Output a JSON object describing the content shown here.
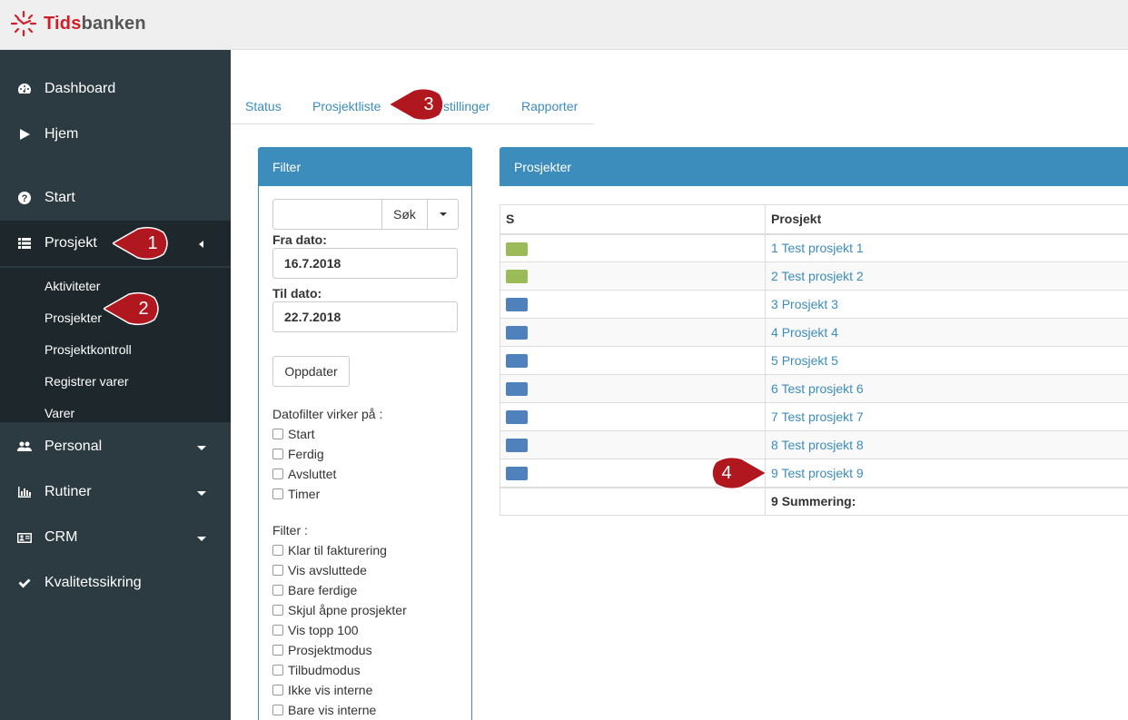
{
  "app": {
    "logo_part1": "Tids",
    "logo_part2": "banken"
  },
  "sidebar": {
    "items": [
      {
        "label": "Dashboard",
        "icon": "dashboard-icon"
      },
      {
        "label": "Hjem",
        "icon": "play-icon"
      },
      {
        "label": "Start",
        "icon": "question-icon"
      },
      {
        "label": "Prosjekt",
        "icon": "list-icon",
        "expanded": true
      },
      {
        "label": "Personal",
        "icon": "users-icon"
      },
      {
        "label": "Rutiner",
        "icon": "bar-chart-icon"
      },
      {
        "label": "CRM",
        "icon": "id-card-icon"
      },
      {
        "label": "Kvalitetssikring",
        "icon": "check-icon"
      }
    ],
    "submenu": [
      "Aktiviteter",
      "Prosjekter",
      "Prosjektkontroll",
      "Registrer varer",
      "Varer"
    ]
  },
  "tabs": [
    "Status",
    "Prosjektliste",
    "stillinger",
    "Rapporter"
  ],
  "filter": {
    "title": "Filter",
    "search_value": "",
    "search_button": "Søk",
    "from_label": "Fra dato:",
    "from_value": "16.7.2018",
    "to_label": "Til dato:",
    "to_value": "22.7.2018",
    "update_button": "Oppdater",
    "datefilter_label": "Datofilter virker på :",
    "datefilter_options": [
      "Start",
      "Ferdig",
      "Avsluttet",
      "Timer"
    ],
    "filter_label": "Filter :",
    "filter_options": [
      "Klar til fakturering",
      "Vis avsluttede",
      "Bare ferdige",
      "Skjul åpne prosjekter",
      "Vis topp 100",
      "Prosjektmodus",
      "Tilbudmodus",
      "Ikke vis interne",
      "Bare vis interne"
    ]
  },
  "projects": {
    "title": "Prosjekter",
    "col_status": "S",
    "col_project": "Prosjekt",
    "rows": [
      {
        "num": "1",
        "name": "Test prosjekt 1",
        "color": "#9bbb59"
      },
      {
        "num": "2",
        "name": "Test prosjekt 2",
        "color": "#9bbb59"
      },
      {
        "num": "3",
        "name": "Prosjekt 3",
        "color": "#4f81bd"
      },
      {
        "num": "4",
        "name": "Prosjekt 4",
        "color": "#4f81bd"
      },
      {
        "num": "5",
        "name": "Prosjekt 5",
        "color": "#4f81bd"
      },
      {
        "num": "6",
        "name": "Test prosjekt 6",
        "color": "#4f81bd"
      },
      {
        "num": "7",
        "name": "Test prosjekt 7",
        "color": "#4f81bd"
      },
      {
        "num": "8",
        "name": "Test prosjekt 8",
        "color": "#4f81bd"
      },
      {
        "num": "9",
        "name": "Test prosjekt 9",
        "color": "#4f81bd"
      }
    ],
    "summary_count": "9",
    "summary_label": "Summering:"
  },
  "callouts": [
    "1",
    "2",
    "3",
    "4"
  ]
}
